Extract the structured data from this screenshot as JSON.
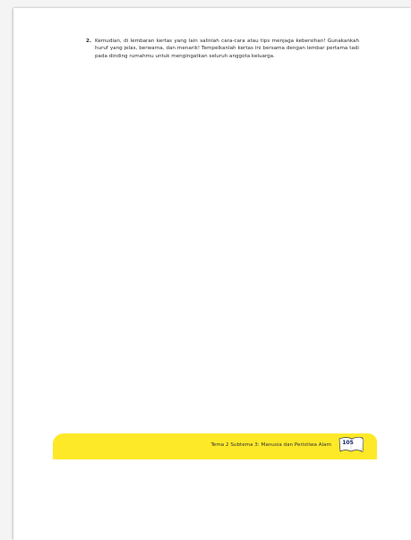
{
  "content": {
    "item_number": "2.",
    "item_text": "Kemudian, di lembaran kertas yang lain salinlah cara-cara atau tips menjaga kebersihan! Gunakankah huruf yang jelas, berwarna, dan menarik! Tempelkanlah kertas ini bersama dengan lembar pertama tadi pada dinding rumahmu untuk mengingatkan seluruh anggota keluarga."
  },
  "footer": {
    "title": "Tema 2 Subtema 3: Manusia dan Peristiwa Alam",
    "page_number": "105",
    "band_color": "#fde928"
  }
}
